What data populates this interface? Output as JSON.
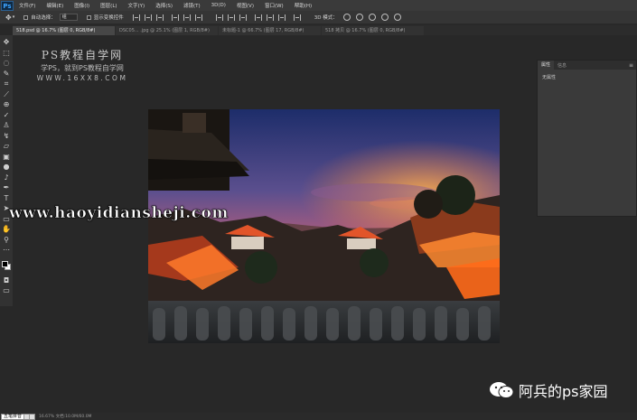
{
  "app": {
    "logo": "Ps"
  },
  "menubar": {
    "items": [
      "文件(F)",
      "编辑(E)",
      "图像(I)",
      "图层(L)",
      "文字(Y)",
      "选择(S)",
      "滤镜(T)",
      "3D(D)",
      "视图(V)",
      "窗口(W)",
      "帮助(H)"
    ]
  },
  "optionsbar": {
    "move_icon": "move-tool-icon",
    "auto_select_label": "自动选择：",
    "auto_select_value": "组",
    "show_transform_label": "显示变换控件",
    "mode_3d_label": "3D 模式："
  },
  "tabs": [
    {
      "label": "518.psd @ 16.7% (图层 0, RGB/8#)",
      "active": true
    },
    {
      "label": "DSC05... .jpg @ 25.1% (图层 1, RGB/8#)",
      "active": false
    },
    {
      "label": "未标题-1 @ 66.7% (图层 17, RGB/8#)",
      "active": false
    },
    {
      "label": "518 拷贝 @ 16.7% (图层 0, RGB/8#)",
      "active": false
    }
  ],
  "watermark": {
    "title": "PS教程自学网",
    "subtitle": "学PS，就到PS教程自学网",
    "url": "WWW.16XX8.COM"
  },
  "overlay_url": "www.haoyidiansheji.com",
  "properties_panel": {
    "tabs": [
      "属性",
      "信息"
    ],
    "body": "无属性"
  },
  "wechat": {
    "icon": "wechat-icon",
    "label": "阿兵的ps家园"
  },
  "statusbar": {
    "ime_label": "五笔拼音",
    "zoom": "16.67%    文档:10.0M/60.0M"
  },
  "colors": {
    "menubar": "#3a3a3a",
    "workspace": "#282828",
    "panel": "#3a3a3a",
    "accent": "#3da3ff"
  }
}
